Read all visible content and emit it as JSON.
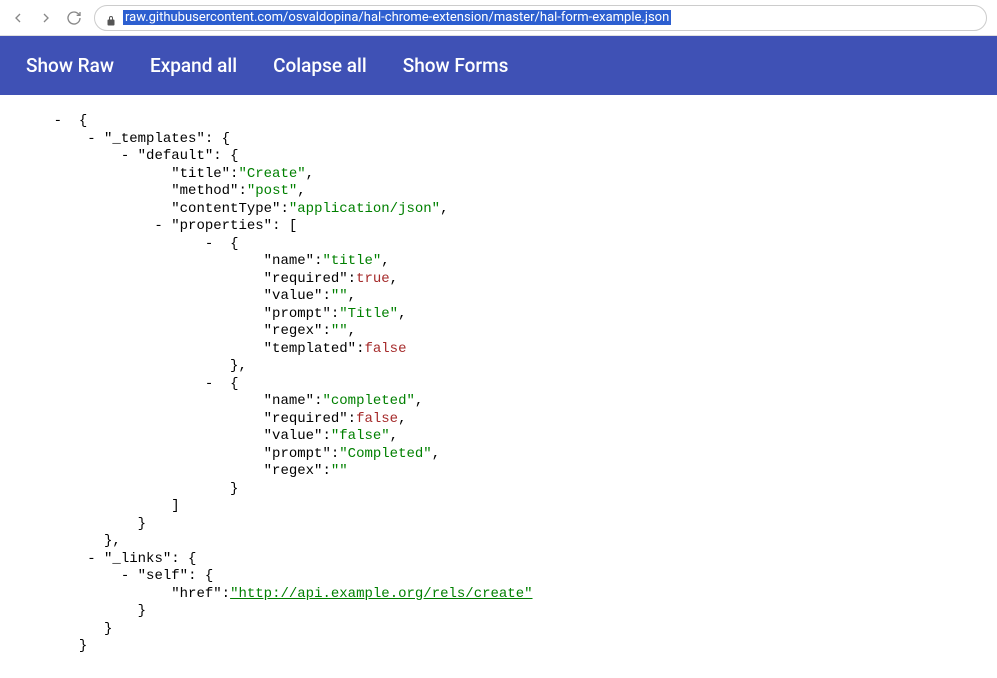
{
  "browser": {
    "url": "raw.githubusercontent.com/osvaldopina/hal-chrome-extension/master/hal-form-example.json"
  },
  "toolbar": {
    "show_raw": "Show Raw",
    "expand_all": "Expand all",
    "collapse_all": "Colapse all",
    "show_forms": "Show Forms"
  },
  "json": {
    "templates_key": "\"_templates\"",
    "default_key": "\"default\"",
    "title_key": "\"title\"",
    "title_val": "\"Create\"",
    "method_key": "\"method\"",
    "method_val": "\"post\"",
    "contentType_key": "\"contentType\"",
    "contentType_val": "\"application/json\"",
    "properties_key": "\"properties\"",
    "p0_name_key": "\"name\"",
    "p0_name_val": "\"title\"",
    "p0_required_key": "\"required\"",
    "p0_required_val": "true",
    "p0_value_key": "\"value\"",
    "p0_value_val": "\"\"",
    "p0_prompt_key": "\"prompt\"",
    "p0_prompt_val": "\"Title\"",
    "p0_regex_key": "\"regex\"",
    "p0_regex_val": "\"\"",
    "p0_templated_key": "\"templated\"",
    "p0_templated_val": "false",
    "p1_name_key": "\"name\"",
    "p1_name_val": "\"completed\"",
    "p1_required_key": "\"required\"",
    "p1_required_val": "false",
    "p1_value_key": "\"value\"",
    "p1_value_val": "\"false\"",
    "p1_prompt_key": "\"prompt\"",
    "p1_prompt_val": "\"Completed\"",
    "p1_regex_key": "\"regex\"",
    "p1_regex_val": "\"\"",
    "links_key": "\"_links\"",
    "self_key": "\"self\"",
    "href_key": "\"href\"",
    "href_val": "\"http://api.example.org/rels/create\""
  }
}
